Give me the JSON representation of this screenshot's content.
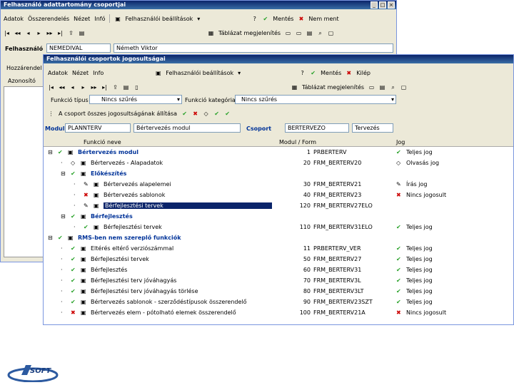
{
  "back": {
    "title": "Felhasználó adattartomány csoportjai",
    "menu": [
      "Adatok",
      "Összerendelés",
      "Nézet",
      "Infó"
    ],
    "settings": "Felhasználói beállítások",
    "ok": "Mentés",
    "cancel": "Nem ment",
    "view": "Táblázat megjelenítés",
    "user_label": "Felhasználó",
    "user_code": "NEMEDIVAL",
    "user_name": "Németh Viktor",
    "side_label": "Hozzárendel",
    "side_item": "Azonosító"
  },
  "front": {
    "title": "Felhasználói csoportok jogosultságai",
    "menu": [
      "Adatok",
      "Nézet",
      "Info"
    ],
    "settings": "Felhasználói beállítások",
    "ok": "Mentés",
    "cancel": "Kilép",
    "view": "Táblázat megjelenítés",
    "func_type_label": "Funkció típus",
    "func_type_value": "Nincs szűrés",
    "func_cat_label": "Funkció kategória",
    "func_cat_value": "Nincs szűrés",
    "group_rights": "A csoport összes jogosultságának állítása",
    "module_label": "Modul",
    "module_code": "PLANNTERV",
    "module_name": "Bértervezés modul",
    "group_label": "Csoport",
    "group_code": "BERTERVEZO",
    "group_name": "Tervezés",
    "col_name": "Funkció neve",
    "col_form": "Modul / Form",
    "col_right": "Jog",
    "rows": [
      {
        "icon": "chk",
        "name": "Bértervezés modul",
        "num": "1",
        "form": "PRBERTERV",
        "right_icon": "chk",
        "right": "Teljes jog",
        "bold": true,
        "indent": 0
      },
      {
        "icon": "diamond",
        "name": "Bértervezés - Alapadatok",
        "num": "20",
        "form": "FRM_BERTERV20",
        "right_icon": "diamond",
        "right": "Olvasás jog",
        "bold": false,
        "indent": 1
      },
      {
        "icon": "chk",
        "name": "Előkészítés",
        "num": "",
        "form": "",
        "right_icon": "",
        "right": "",
        "bold": true,
        "indent": 1
      },
      {
        "icon": "pen",
        "name": "Bértervezés alapelemei",
        "num": "30",
        "form": "FRM_BERTERV21",
        "right_icon": "pen",
        "right": "Írás jog",
        "bold": false,
        "indent": 2
      },
      {
        "icon": "crs",
        "name": "Bértervezés sablonok",
        "num": "40",
        "form": "FRM_BERTERV23",
        "right_icon": "crs",
        "right": "Nincs jogosult",
        "bold": false,
        "indent": 2
      },
      {
        "icon": "pen",
        "name": "Bérfejlesztési tervek",
        "num": "120",
        "form": "FRM_BERTERV27ELO",
        "right_icon": "",
        "right": "",
        "bold": false,
        "indent": 2,
        "selected": true
      },
      {
        "icon": "chk",
        "name": "Bérfejlesztés",
        "num": "",
        "form": "",
        "right_icon": "",
        "right": "",
        "bold": true,
        "indent": 1
      },
      {
        "icon": "chk",
        "name": "Bérfejlesztési tervek",
        "num": "110",
        "form": "FRM_BERTERV31ELO",
        "right_icon": "chk",
        "right": "Teljes jog",
        "bold": false,
        "indent": 2
      },
      {
        "icon": "chk",
        "name": "RMS-ben nem szereplő funkciók",
        "num": "",
        "form": "",
        "right_icon": "",
        "right": "",
        "bold": true,
        "indent": 0
      },
      {
        "icon": "chk",
        "name": "Eltérés eltérő verziószámmal",
        "num": "11",
        "form": "PRBERTERV_VER",
        "right_icon": "chk",
        "right": "Teljes jog",
        "bold": false,
        "indent": 1
      },
      {
        "icon": "chk",
        "name": "Bérfejlesztési tervek",
        "num": "50",
        "form": "FRM_BERTERV27",
        "right_icon": "chk",
        "right": "Teljes jog",
        "bold": false,
        "indent": 1
      },
      {
        "icon": "chk",
        "name": "Bérfejlesztés",
        "num": "60",
        "form": "FRM_BERTERV31",
        "right_icon": "chk",
        "right": "Teljes jog",
        "bold": false,
        "indent": 1
      },
      {
        "icon": "chk",
        "name": "Bérfejlesztési terv jóváhagyás",
        "num": "70",
        "form": "FRM_BERTERV3L",
        "right_icon": "chk",
        "right": "Teljes jog",
        "bold": false,
        "indent": 1
      },
      {
        "icon": "chk",
        "name": "Bérfejlesztési terv jóváhagyás törlése",
        "num": "80",
        "form": "FRM_BERTERV3LT",
        "right_icon": "chk",
        "right": "Teljes jog",
        "bold": false,
        "indent": 1
      },
      {
        "icon": "chk",
        "name": "Bértervezés sablonok - szerződéstípusok összerendelő",
        "num": "90",
        "form": "FRM_BERTERV23SZT",
        "right_icon": "chk",
        "right": "Teljes jog",
        "bold": false,
        "indent": 1
      },
      {
        "icon": "crs",
        "name": "Bértervezés elem - pótolható elemek összerendelő",
        "num": "100",
        "form": "FRM_BERTERV21A",
        "right_icon": "crs",
        "right": "Nincs jogosult",
        "bold": false,
        "indent": 1
      }
    ]
  },
  "logo": "SOFT"
}
